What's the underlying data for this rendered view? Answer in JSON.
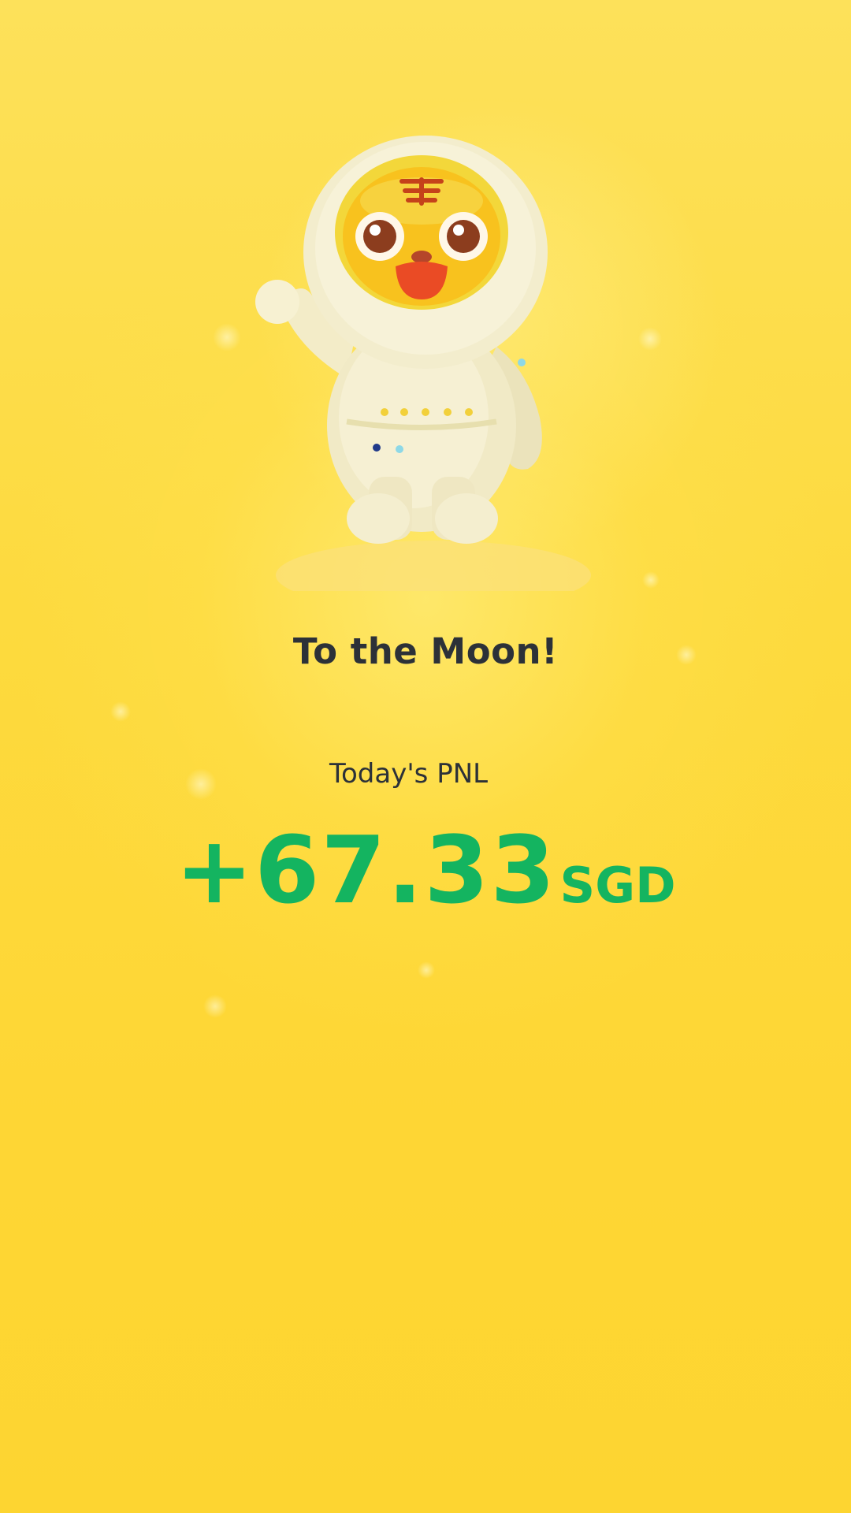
{
  "header": {
    "title": "To the Moon!"
  },
  "pnl": {
    "label": "Today's PNL",
    "amount": "+67.33",
    "currency": "SGD",
    "positive_color": "#14b460"
  },
  "illustration": {
    "icon": "tiger-astronaut-mascot"
  },
  "theme": {
    "background": "#fdd938",
    "text": "#2c3138"
  }
}
